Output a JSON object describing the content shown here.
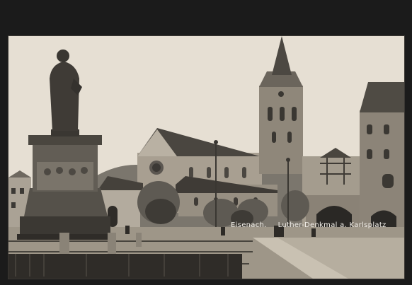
{
  "caption": {
    "place": "Eisenach.",
    "subject": "Luther-Denkmal a. Karlsplatz"
  },
  "colors": {
    "sky": "#e4ddd1",
    "stone_light": "#b8b0a2",
    "stone_mid": "#8a8277",
    "stone_dark": "#4d4943",
    "shadow": "#262421",
    "border": "#1b1b1b"
  }
}
